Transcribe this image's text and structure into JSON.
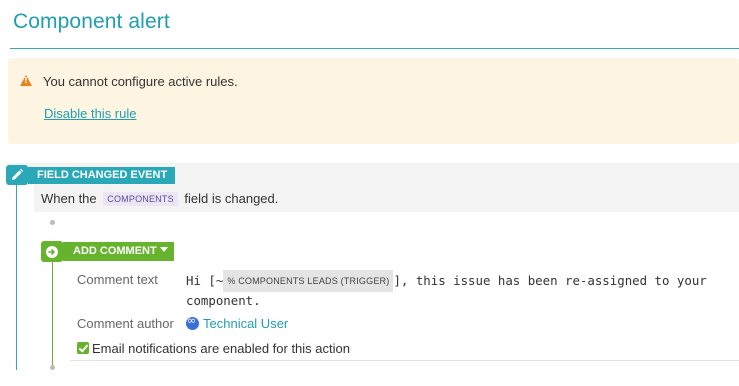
{
  "page": {
    "title": "Component alert"
  },
  "warning": {
    "message": "You cannot configure active rules.",
    "link_label": "Disable this rule",
    "icon": "warning-triangle-icon",
    "color": "#e8821c",
    "background": "#fdf5e1"
  },
  "trigger": {
    "label": "FIELD CHANGED EVENT",
    "icon": "pencil-icon",
    "color": "#2aa8b8",
    "desc_prefix": "When the",
    "field": "COMPONENTS",
    "desc_suffix": "field is changed."
  },
  "action": {
    "label": "ADD COMMENT",
    "icon": "arrow-right-circle-icon",
    "dropdown_icon": "caret-down-icon",
    "color": "#66b32e",
    "comment_text_label": "Comment text",
    "comment_prefix": "Hi [~",
    "smart_value": "% COMPONENTS LEADS (TRIGGER)",
    "comment_suffix": "], this issue has been re-assigned to your component.",
    "comment_author_label": "Comment author",
    "author_name": "Technical User",
    "author_icon": "user-avatar-icon",
    "email_notice": "Email notifications are enabled for this action",
    "email_icon": "checkbox-checked-icon"
  }
}
